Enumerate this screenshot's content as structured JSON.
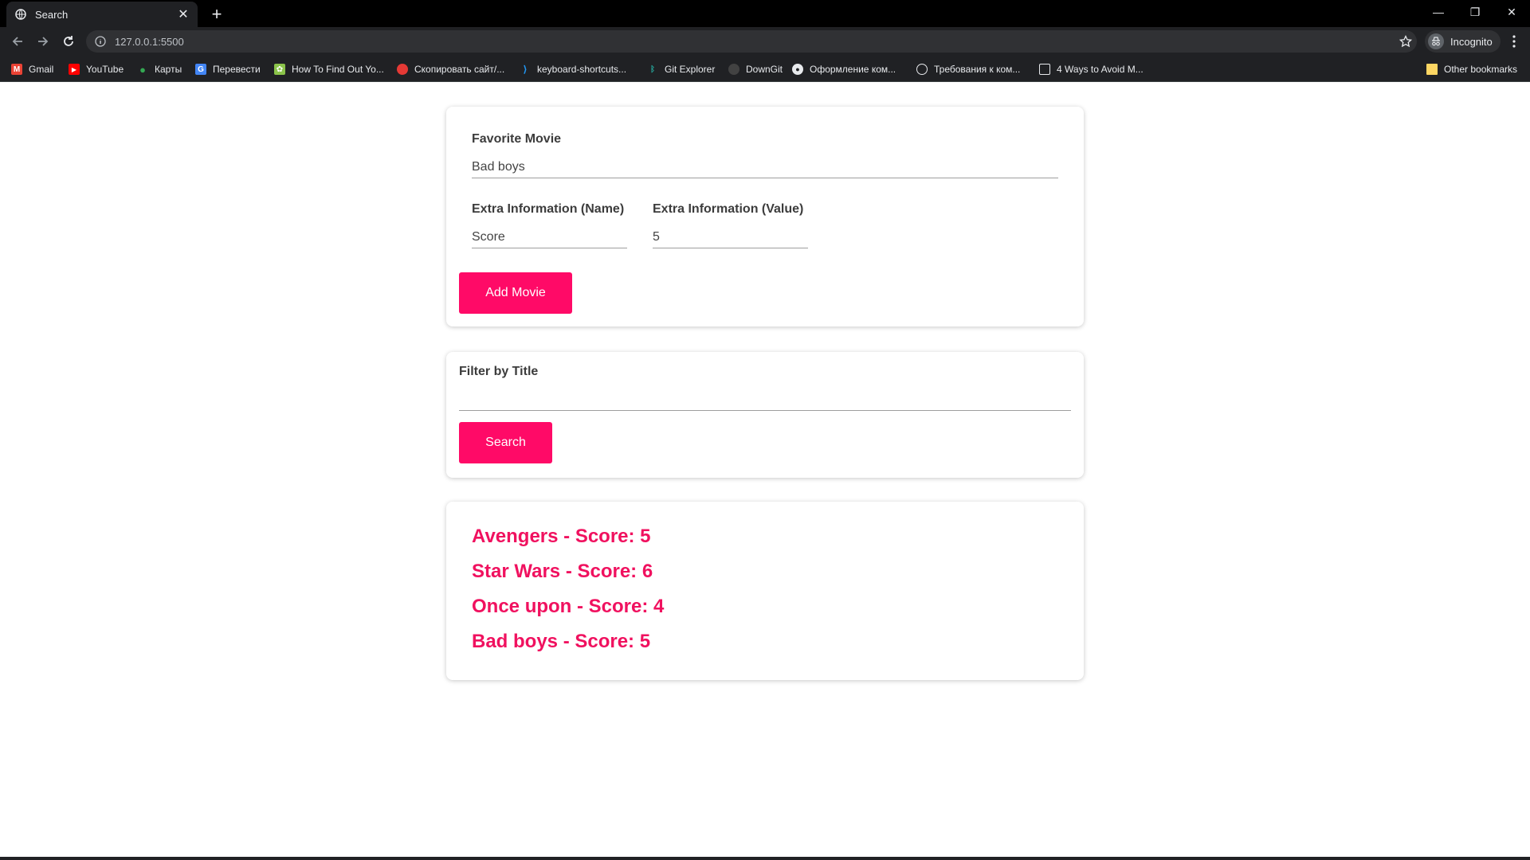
{
  "browser": {
    "tab_title": "Search",
    "url": "127.0.0.1:5500",
    "profile_label": "Incognito",
    "bookmarks": [
      {
        "label": "Gmail",
        "icon": "gmail-icon",
        "color": "#ea4335"
      },
      {
        "label": "YouTube",
        "icon": "youtube-icon",
        "color": "#ff0000"
      },
      {
        "label": "Карты",
        "icon": "maps-icon",
        "color": "#34a853"
      },
      {
        "label": "Перевести",
        "icon": "translate-icon",
        "color": "#4285f4"
      },
      {
        "label": "How To Find Out Yo...",
        "icon": "site-icon",
        "color": "#8bc34a"
      },
      {
        "label": "Скопировать сайт/...",
        "icon": "site-icon",
        "color": "#e53935"
      },
      {
        "label": "keyboard-shortcuts...",
        "icon": "vscode-icon",
        "color": "#2196f3"
      },
      {
        "label": "Git Explorer",
        "icon": "git-explorer-icon",
        "color": "#26a69a"
      },
      {
        "label": "DownGit",
        "icon": "downgit-icon",
        "color": "#424242"
      },
      {
        "label": "Оформление ком...",
        "icon": "github-icon",
        "color": "#e8eaed"
      },
      {
        "label": "Требования к ком...",
        "icon": "globe-icon",
        "color": "#e8eaed"
      },
      {
        "label": "4 Ways to Avoid M...",
        "icon": "site-icon",
        "color": "#e8eaed"
      }
    ],
    "other_bookmarks": "Other bookmarks"
  },
  "form": {
    "favorite_label": "Favorite Movie",
    "favorite_value": "Bad boys",
    "extra_name_label": "Extra Information (Name)",
    "extra_name_value": "Score",
    "extra_value_label": "Extra Information (Value)",
    "extra_value_value": "5",
    "add_button": "Add Movie"
  },
  "filter": {
    "label": "Filter by Title",
    "value": "",
    "search_button": "Search"
  },
  "movies": [
    "Avengers - Score: 5",
    "Star Wars - Score: 6",
    "Once upon - Score: 4",
    "Bad boys - Score: 5"
  ],
  "colors": {
    "accent": "#ff0a67",
    "movie_text": "#f0115f"
  }
}
